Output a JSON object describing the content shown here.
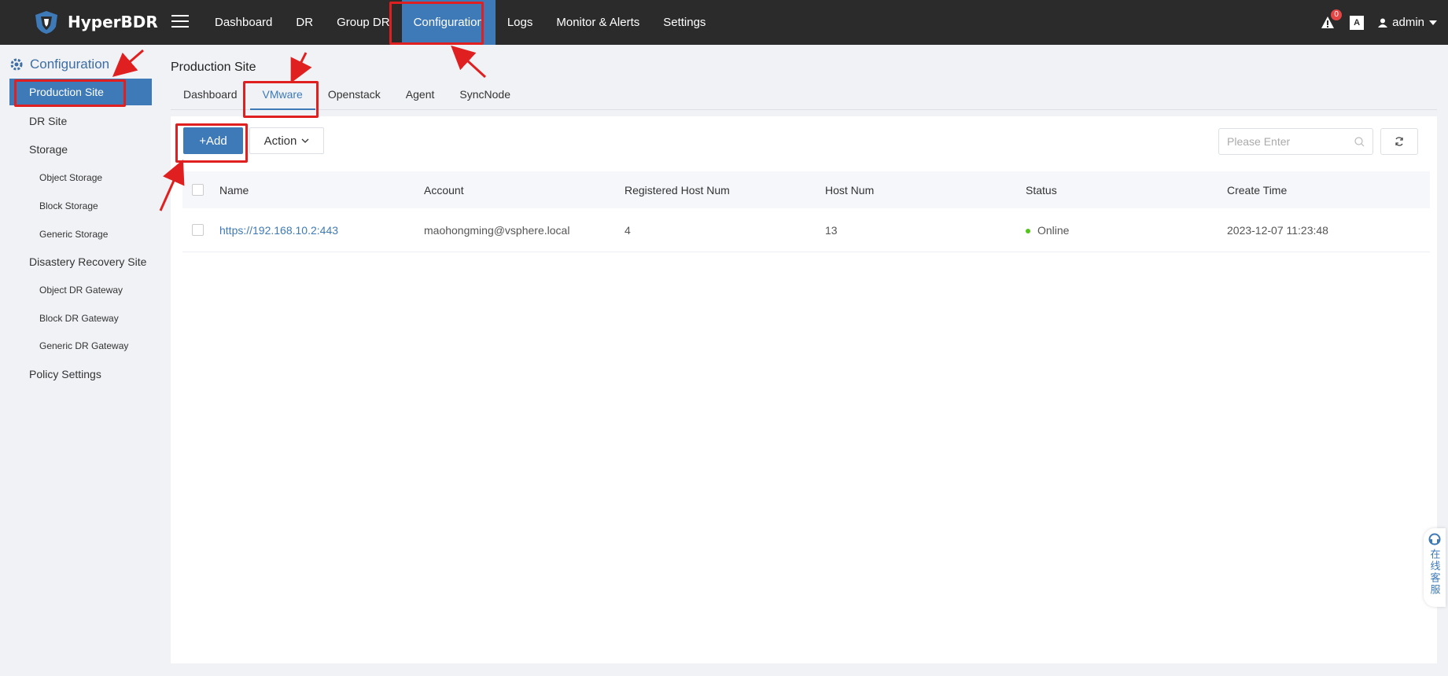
{
  "app": {
    "name": "HyperBDR"
  },
  "topnav": {
    "items": [
      {
        "label": "Dashboard"
      },
      {
        "label": "DR"
      },
      {
        "label": "Group DR"
      },
      {
        "label": "Configuration"
      },
      {
        "label": "Logs"
      },
      {
        "label": "Monitor & Alerts"
      },
      {
        "label": "Settings"
      }
    ],
    "active": "Configuration",
    "alert_count": "0",
    "lang_label": "A",
    "user": "admin"
  },
  "sidebar": {
    "header": "Configuration",
    "items": [
      {
        "label": "Production Site"
      },
      {
        "label": "DR Site"
      },
      {
        "label": "Storage"
      },
      {
        "label": "Object Storage"
      },
      {
        "label": "Block Storage"
      },
      {
        "label": "Generic Storage"
      },
      {
        "label": "Disastery Recovery Site"
      },
      {
        "label": "Object DR Gateway"
      },
      {
        "label": "Block DR Gateway"
      },
      {
        "label": "Generic DR Gateway"
      },
      {
        "label": "Policy Settings"
      }
    ],
    "active": "Production Site"
  },
  "page": {
    "title": "Production Site",
    "tabs": [
      {
        "label": "Dashboard"
      },
      {
        "label": "VMware"
      },
      {
        "label": "Openstack"
      },
      {
        "label": "Agent"
      },
      {
        "label": "SyncNode"
      }
    ],
    "active_tab": "VMware"
  },
  "toolbar": {
    "add_label": "+Add",
    "action_label": "Action",
    "search_placeholder": "Please Enter"
  },
  "table": {
    "columns": [
      "Name",
      "Account",
      "Registered Host Num",
      "Host Num",
      "Status",
      "Create Time"
    ],
    "rows": [
      {
        "name": "https://192.168.10.2:443",
        "account": "maohongming@vsphere.local",
        "registered_host_num": "4",
        "host_num": "13",
        "status": "Online",
        "create_time": "2023-12-07 11:23:48"
      }
    ]
  },
  "service_widget": {
    "label": "在线客服"
  },
  "colors": {
    "topbar": "#2b2b2b",
    "accent": "#3e7ab7",
    "highlight": "#e02020",
    "online": "#52c41a"
  }
}
